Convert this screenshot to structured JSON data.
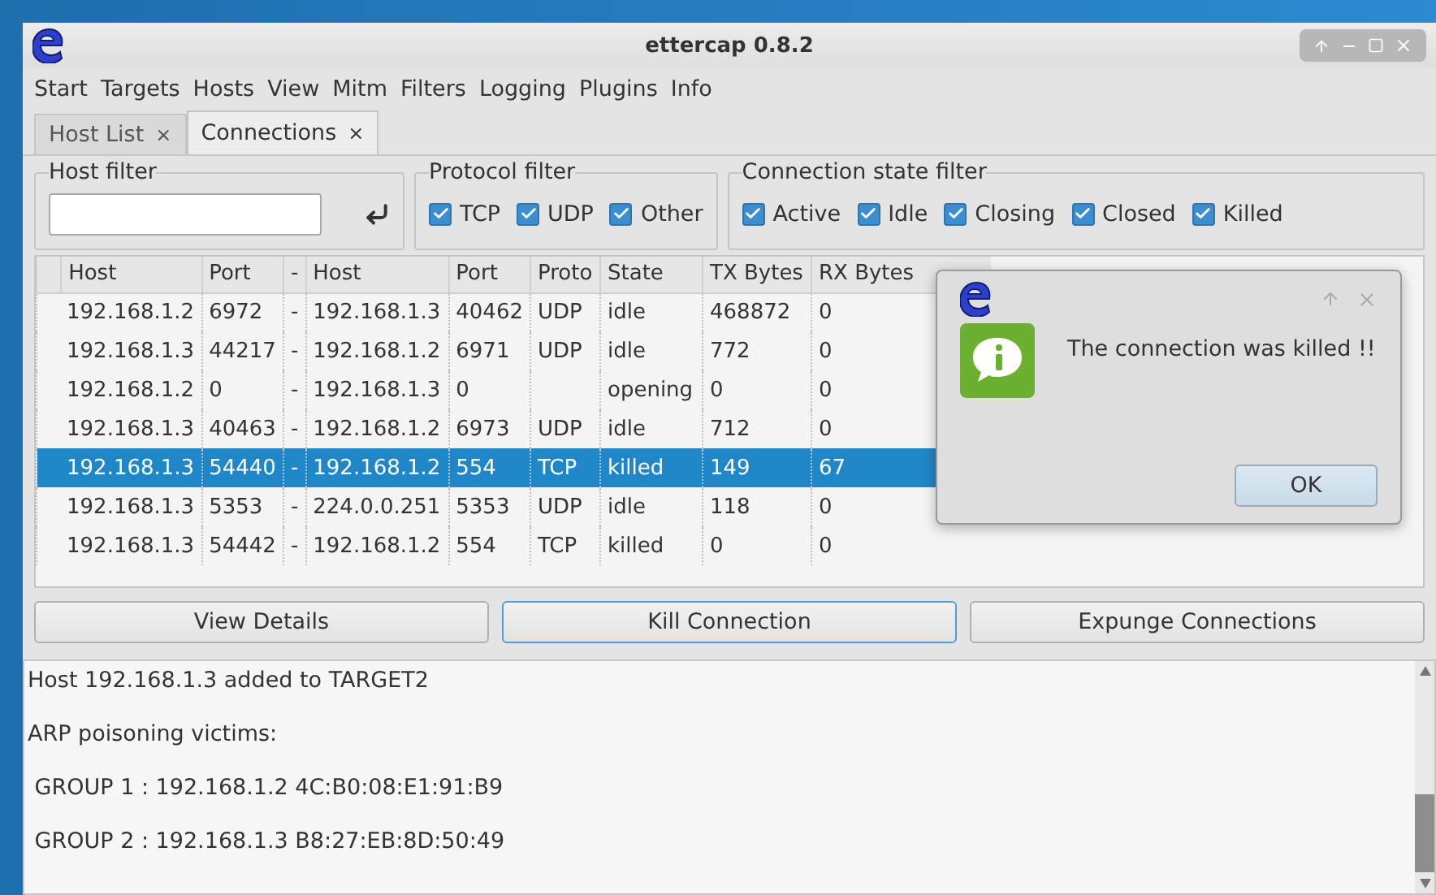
{
  "window": {
    "title": "ettercap 0.8.2"
  },
  "menu": [
    "Start",
    "Targets",
    "Hosts",
    "View",
    "Mitm",
    "Filters",
    "Logging",
    "Plugins",
    "Info"
  ],
  "tabs": [
    {
      "label": "Host List",
      "close": "×",
      "selected": false
    },
    {
      "label": "Connections",
      "close": "×",
      "selected": true
    }
  ],
  "host_filter": {
    "label": "Host filter"
  },
  "protocol_filter": {
    "label": "Protocol filter",
    "options": [
      {
        "label": "TCP",
        "checked": true
      },
      {
        "label": "UDP",
        "checked": true
      },
      {
        "label": "Other",
        "checked": true
      }
    ]
  },
  "state_filter": {
    "label": "Connection state filter",
    "options": [
      {
        "label": "Active",
        "checked": true
      },
      {
        "label": "Idle",
        "checked": true
      },
      {
        "label": "Closing",
        "checked": true
      },
      {
        "label": "Closed",
        "checked": true
      },
      {
        "label": "Killed",
        "checked": true
      }
    ]
  },
  "table": {
    "columns": [
      "Host",
      "Port",
      "-",
      "Host",
      "Port",
      "Proto",
      "State",
      "TX Bytes",
      "RX Bytes"
    ],
    "rows": [
      {
        "cells": [
          "192.168.1.2",
          "6972",
          "-",
          "192.168.1.3",
          "40462",
          "UDP",
          "idle",
          "468872",
          "0"
        ],
        "selected": false
      },
      {
        "cells": [
          "192.168.1.3",
          "44217",
          "-",
          "192.168.1.2",
          "6971",
          "UDP",
          "idle",
          "772",
          "0"
        ],
        "selected": false
      },
      {
        "cells": [
          "192.168.1.2",
          "0",
          "-",
          "192.168.1.3",
          "0",
          "",
          "opening",
          "0",
          "0"
        ],
        "selected": false
      },
      {
        "cells": [
          "192.168.1.3",
          "40463",
          "-",
          "192.168.1.2",
          "6973",
          "UDP",
          "idle",
          "712",
          "0"
        ],
        "selected": false
      },
      {
        "cells": [
          "192.168.1.3",
          "54440",
          "-",
          "192.168.1.2",
          "554",
          "TCP",
          "killed",
          "149",
          "67"
        ],
        "selected": true
      },
      {
        "cells": [
          "192.168.1.3",
          "5353",
          "-",
          "224.0.0.251",
          "5353",
          "UDP",
          "idle",
          "118",
          "0"
        ],
        "selected": false
      },
      {
        "cells": [
          "192.168.1.3",
          "54442",
          "-",
          "192.168.1.2",
          "554",
          "TCP",
          "killed",
          "0",
          "0"
        ],
        "selected": false
      }
    ]
  },
  "buttons": [
    {
      "label": "View Details",
      "focused": false
    },
    {
      "label": "Kill Connection",
      "focused": true
    },
    {
      "label": "Expunge Connections",
      "focused": false
    }
  ],
  "log": [
    "Host 192.168.1.3 added to TARGET2",
    "ARP poisoning victims:",
    " GROUP 1 : 192.168.1.2 4C:B0:08:E1:91:B9",
    " GROUP 2 : 192.168.1.3 B8:27:EB:8D:50:49"
  ],
  "dialog": {
    "message": "The connection was killed !!",
    "button": "OK"
  }
}
